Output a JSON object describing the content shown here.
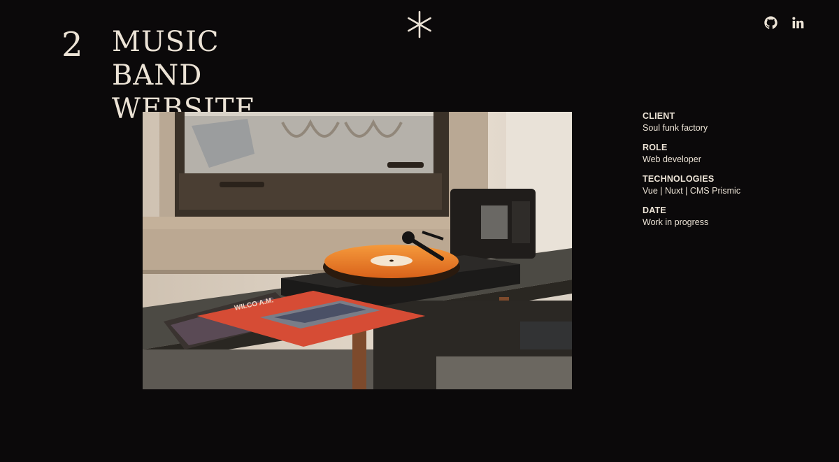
{
  "project": {
    "number": "2",
    "title_line1": "MUSIC BAND",
    "title_line2": "WEBSITE"
  },
  "header": {
    "star_icon": "asterisk-star-icon",
    "social": [
      {
        "name": "github",
        "icon": "github-icon"
      },
      {
        "name": "linkedin",
        "icon": "linkedin-icon"
      }
    ]
  },
  "photo": {
    "description_icon": "project-photo",
    "record_label": "WILCO   A.M."
  },
  "details": {
    "client_label": "CLIENT",
    "client_value": "Soul funk factory",
    "role_label": "ROLE",
    "role_value": "Web developer",
    "technologies_label": "TECHNOLOGIES",
    "technologies_value": "Vue | Nuxt | CMS Prismic",
    "date_label": "DATE",
    "date_value": "Work in progress"
  },
  "colors": {
    "background": "#0b090a",
    "text": "#ece3d6",
    "vinyl": "#f07f26"
  }
}
